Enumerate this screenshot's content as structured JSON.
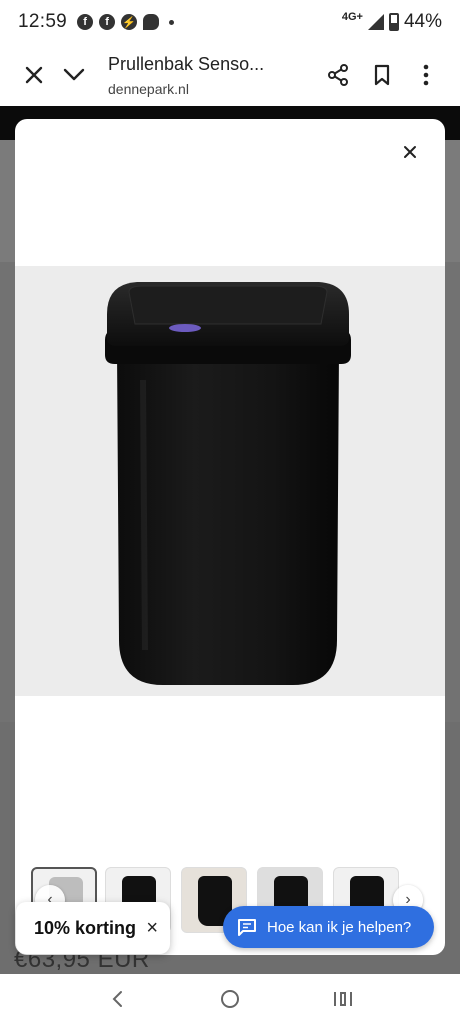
{
  "status_bar": {
    "time": "12:59",
    "network": "4G+",
    "battery": "44%",
    "notification_icons": [
      "facebook-icon",
      "facebook-icon",
      "messenger-icon",
      "chat-icon"
    ]
  },
  "browser": {
    "page_title": "Prullenbak Senso...",
    "domain": "dennepark.nl"
  },
  "background_page": {
    "price_partial": "€63,95 EUR"
  },
  "modal": {
    "close_label": "×",
    "thumbnails": [
      {
        "name": "thumbnail-1",
        "style": "grey"
      },
      {
        "name": "thumbnail-2",
        "style": "black"
      },
      {
        "name": "thumbnail-3",
        "style": "black"
      },
      {
        "name": "thumbnail-4",
        "style": "black"
      },
      {
        "name": "thumbnail-5",
        "style": "black"
      }
    ]
  },
  "chips": {
    "discount_label": "10% korting",
    "discount_close": "×",
    "help_label": "Hoe kan ik je helpen?"
  },
  "colors": {
    "help_button": "#2f6fe0",
    "banner": "#0b0b0b",
    "product_bg": "#ececec"
  }
}
